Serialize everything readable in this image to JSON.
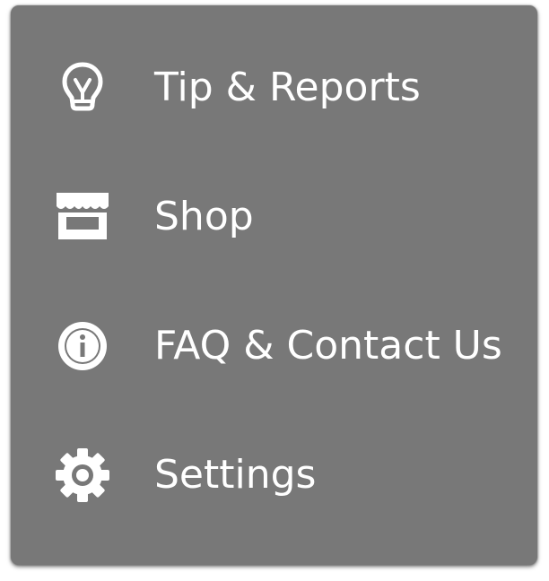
{
  "menu": {
    "items": [
      {
        "label": "Tip & Reports",
        "icon": "lightbulb-icon"
      },
      {
        "label": "Shop",
        "icon": "storefront-icon"
      },
      {
        "label": "FAQ & Contact Us",
        "icon": "info-icon"
      },
      {
        "label": "Settings",
        "icon": "gear-icon"
      }
    ]
  },
  "colors": {
    "menu_background": "#787878",
    "foreground": "#ffffff"
  }
}
